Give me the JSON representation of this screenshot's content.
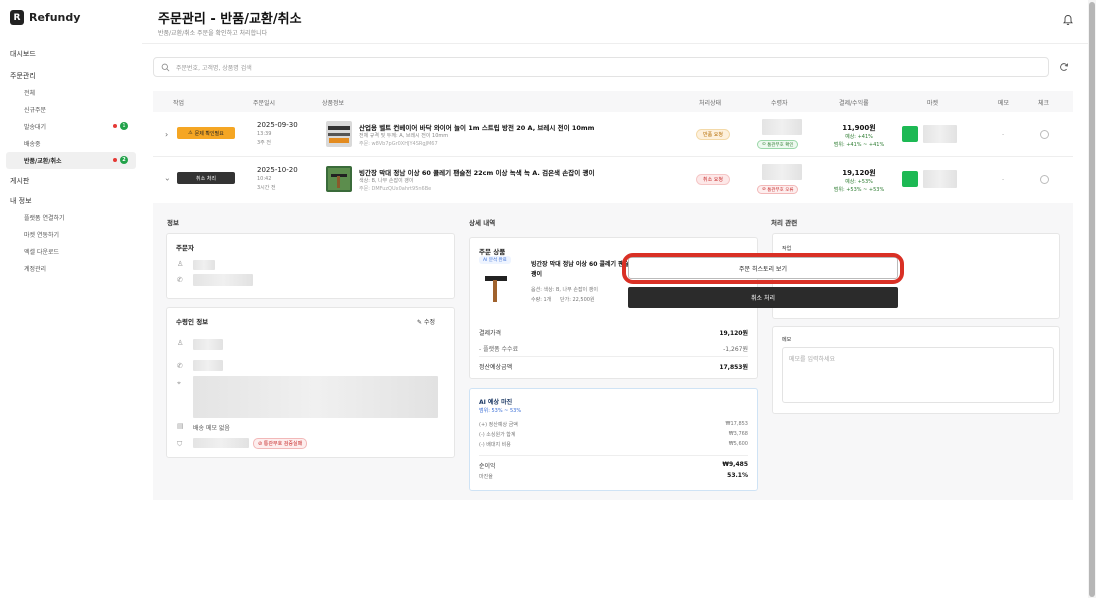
{
  "brand": {
    "name": "Refundy",
    "logo_letter": "R"
  },
  "sidebar": {
    "items": [
      {
        "label": "대시보드"
      },
      {
        "label": "주문관리"
      },
      {
        "label": "전체"
      },
      {
        "label": "신규주문"
      },
      {
        "label": "발송대기"
      },
      {
        "label": "배송중"
      },
      {
        "label": "반품/교환/취소"
      },
      {
        "label": "게시판"
      },
      {
        "label": "내 정보"
      },
      {
        "label": "플랫폼 연결하기"
      },
      {
        "label": "마켓 연동하기"
      },
      {
        "label": "엑셀 다운로드"
      },
      {
        "label": "계정관리"
      }
    ],
    "badges": {
      "shipping_wait": "1",
      "returns": "2"
    }
  },
  "header": {
    "title": "주문관리 - 반품/교환/취소",
    "subtitle": "반품/교환/취소 주문을 확인하고 처리합니다"
  },
  "search": {
    "placeholder": "주문번호, 고객명, 상품명 검색"
  },
  "table": {
    "columns": [
      "작업",
      "주문일시",
      "상품정보",
      "처리상태",
      "수령자",
      "결제/수익률",
      "마켓",
      "메모",
      "체크"
    ],
    "rows": [
      {
        "action_label": "문제 확인필요",
        "date": "2025-09-30",
        "time": "13:39",
        "ago": "3주 전",
        "product_name": "산업용 벨트 컨베이어 바닥 와이어 늘이 1m 스트립 방전 20 A, 브레시 전이 10mm",
        "option": "전체 규격 및 두께: A, 브레시 전이 10mm",
        "code": "주문: w8Vb7pGr0XHJY4SRgJM67",
        "status": "반품 요청",
        "recv_status": "통관부호 확인",
        "amount": "11,900원",
        "margin1": "예상: +41%",
        "margin2": "범위: +41% ~ +41%",
        "memo": "-"
      },
      {
        "action_label": "취소 처리",
        "date": "2025-10-20",
        "time": "10:42",
        "ago": "3시간 전",
        "product_name": "빙간장 막대 정남 이상 60 콜레기 팬슬전 22cm 이상 녹색 녹 A. 검은색 손잡이 괭이",
        "option": "색상: B, 나무 손잡이 괭이",
        "code": "주문: DMFuzQUx0ahrt95n6Be",
        "status": "취소 요청",
        "recv_status": "통관부호 오류",
        "amount": "19,120원",
        "margin1": "예상: +53%",
        "margin2": "범위: +53% ~ +53%",
        "memo": "-"
      }
    ]
  },
  "detail": {
    "info_title": "정보",
    "orderer_title": "주문자",
    "recipient_title": "수령인 정보",
    "edit_label": "수정",
    "delivery_memo": "배송 메모 없음",
    "customs_badge": "통관부호 검증실패",
    "history_title": "상세 내역",
    "product_card_title": "주문 상품",
    "ai_badge": "AI 분석 완료",
    "product_name": "빙간장 막대 정남 이상 60 콜레기 팬슬전 22cm 이상 녹색 녹 A. 검은색 손잡이 괭이",
    "product_option": "옵션: 색상: B, 나무 손잡이 괭이",
    "product_qty": "수량: 1개",
    "product_unit": "단가: 22,500원",
    "payment_label": "결제가격",
    "payment_value": "19,120원",
    "fee_label": "- 플랫폼 수수료",
    "fee_value": "-1,267원",
    "settle_label": "정산예상금액",
    "settle_value": "17,853원",
    "ai_title": "AI 예상 마진",
    "ai_range": "범위: 53% ~ 53%",
    "ai_lines": [
      {
        "label": "(+) 정산예상 금액",
        "value": "₩17,853"
      },
      {
        "label": "(-) 소싱원가 합계",
        "value": "₩3,768"
      },
      {
        "label": "(-) 배대지 비용",
        "value": "₩5,600"
      }
    ],
    "profit_label": "순이익",
    "profit_value": "₩9,485",
    "margin_label": "마진율",
    "margin_value": "53.1%",
    "process_title": "처리 관련",
    "work_label": "작업",
    "history_button": "주문 히스토리 보기",
    "cancel_button": "취소 처리",
    "memo_label": "메모",
    "memo_placeholder": "메모를 입력하세요"
  },
  "colors": {
    "accent_orange": "#f5a623",
    "highlight_red": "#d93025",
    "success_green": "#22a24a",
    "dark_button": "#2b2b2b"
  }
}
